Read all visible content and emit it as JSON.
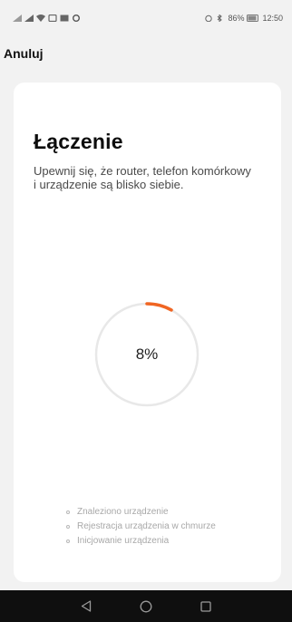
{
  "status_bar": {
    "battery_percent": "86%",
    "time": "12:50"
  },
  "header": {
    "cancel_label": "Anuluj"
  },
  "connecting": {
    "title": "Łączenie",
    "description": "Upewnij się, że router, telefon komórkowy i urządzenie są blisko siebie.",
    "progress": 0.08,
    "progress_label": "8%",
    "accent_color": "#f06522",
    "track_color": "#e8e8e8"
  },
  "steps": [
    {
      "label": "Znaleziono urządzenie"
    },
    {
      "label": "Rejestracja urządzenia w chmurze"
    },
    {
      "label": "Inicjowanie urządzenia"
    }
  ],
  "nav": {
    "back_icon": "back-triangle-icon",
    "home_icon": "home-circle-icon",
    "recents_icon": "recents-square-icon"
  }
}
